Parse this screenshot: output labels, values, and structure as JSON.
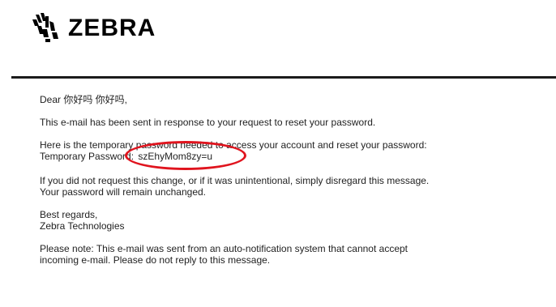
{
  "brand": {
    "name": "ZEBRA",
    "logo_icon": "zebra-head-icon"
  },
  "email": {
    "greeting": "Dear 你好吗 你好吗,",
    "intro": "This e-mail has been sent in response to your request to reset your password.",
    "temp_intro": "Here is the temporary password needed to access your account and reset your password:",
    "temp_label": "Temporary Password:",
    "temp_password": "szEhyMom8zy=u",
    "disregard_line1": "If you did not request this change, or if it was unintentional, simply disregard this message.",
    "disregard_line2": "Your password will remain unchanged.",
    "signoff_line1": "Best regards,",
    "signoff_line2": "Zebra Technologies",
    "note_line1": "Please note: This e-mail was sent from an auto-notification system that cannot accept",
    "note_line2": "incoming e-mail. Please do not reply to this message."
  },
  "colors": {
    "highlight_circle": "#e0141e",
    "divider": "#1b1b1b"
  }
}
